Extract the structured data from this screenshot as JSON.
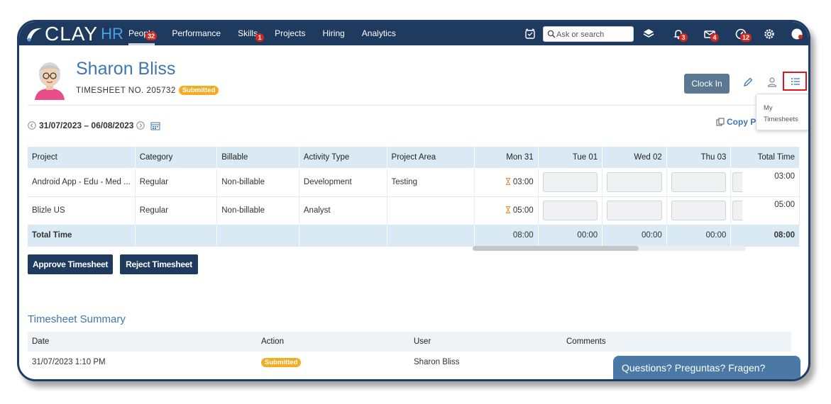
{
  "app": {
    "logo_main": "CLAY",
    "logo_suffix": "HR"
  },
  "nav": {
    "items": [
      {
        "label": "People",
        "badge": "32"
      },
      {
        "label": "Performance",
        "badge": ""
      },
      {
        "label": "Skills",
        "badge": "1"
      },
      {
        "label": "Projects",
        "badge": ""
      },
      {
        "label": "Hiring",
        "badge": ""
      },
      {
        "label": "Analytics",
        "badge": ""
      }
    ],
    "active": "People",
    "search_placeholder": "Ask or search",
    "badges": {
      "bell": "3",
      "mail": "4",
      "speed": "12"
    }
  },
  "header": {
    "name": "Sharon Bliss",
    "timesheet_label": "TIMESHEET NO. 205732",
    "status": "Submitted",
    "clock_in": "Clock In",
    "menu_item": "My Timesheets"
  },
  "period": {
    "range": "31/07/2023 – 06/08/2023",
    "copy_label": "Copy Pr"
  },
  "grid": {
    "columns": [
      "Project",
      "Category",
      "Billable",
      "Activity Type",
      "Project Area",
      "Mon 31",
      "Tue 01",
      "Wed 02",
      "Thu 03",
      "Total Time"
    ],
    "rows": [
      {
        "project": "Android App - Edu - Med ...",
        "category": "Regular",
        "billable": "Non-billable",
        "activity": "Development",
        "area": "Testing",
        "mon": "03:00",
        "total": "03:00"
      },
      {
        "project": "Blizle US",
        "category": "Regular",
        "billable": "Non-billable",
        "activity": "Analyst",
        "area": "",
        "mon": "05:00",
        "total": "05:00"
      }
    ],
    "total_row": {
      "label": "Total Time",
      "mon": "08:00",
      "tue": "00:00",
      "wed": "00:00",
      "thu": "00:00",
      "total": "08:00"
    }
  },
  "actions": {
    "approve": "Approve Timesheet",
    "reject": "Reject Timesheet"
  },
  "summary": {
    "title": "Timesheet Summary",
    "columns": [
      "Date",
      "Action",
      "User",
      "Comments"
    ],
    "rows": [
      {
        "date": "31/07/2023 1:10 PM",
        "action": "Submitted",
        "user": "Sharon Bliss",
        "comments": ""
      }
    ]
  },
  "help": {
    "label": "Questions? Preguntas? Fragen?"
  },
  "colors": {
    "nav_bg": "#1f3a5f",
    "accent": "#3e76b4",
    "status_pill": "#f3ad22",
    "badge": "#d9261c",
    "header_row": "#d9eaf5"
  }
}
